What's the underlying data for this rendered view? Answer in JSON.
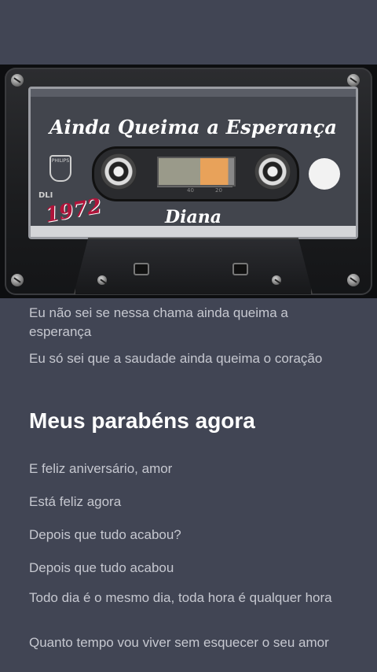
{
  "cassette": {
    "title": "Ainda Queima a Esperança",
    "artist": "Diana",
    "year": "1972",
    "brand": "PHILIPS",
    "side_mark": "DLI"
  },
  "lyrics": [
    {
      "text": "Eu não sei se nessa chama ainda queima a esperança",
      "active": false
    },
    {
      "text": "Eu só sei que a saudade ainda queima o coração",
      "active": false
    },
    {
      "text": "Meus parabéns agora",
      "active": true
    },
    {
      "text": "E feliz aniversário, amor",
      "active": false
    },
    {
      "text": "Está feliz agora",
      "active": false
    },
    {
      "text": "Depois que tudo acabou?",
      "active": false
    },
    {
      "text": "Depois que tudo acabou",
      "active": false
    },
    {
      "text": "Todo dia é o mesmo dia, toda hora é qualquer hora",
      "active": false
    },
    {
      "text": "Quanto tempo vou viver sem esquecer o seu amor",
      "active": false
    }
  ],
  "colors": {
    "background": "#3f4452",
    "lyric_inactive": "#c6c8d0",
    "lyric_active": "#ffffff",
    "year_accent": "#b0143a"
  }
}
